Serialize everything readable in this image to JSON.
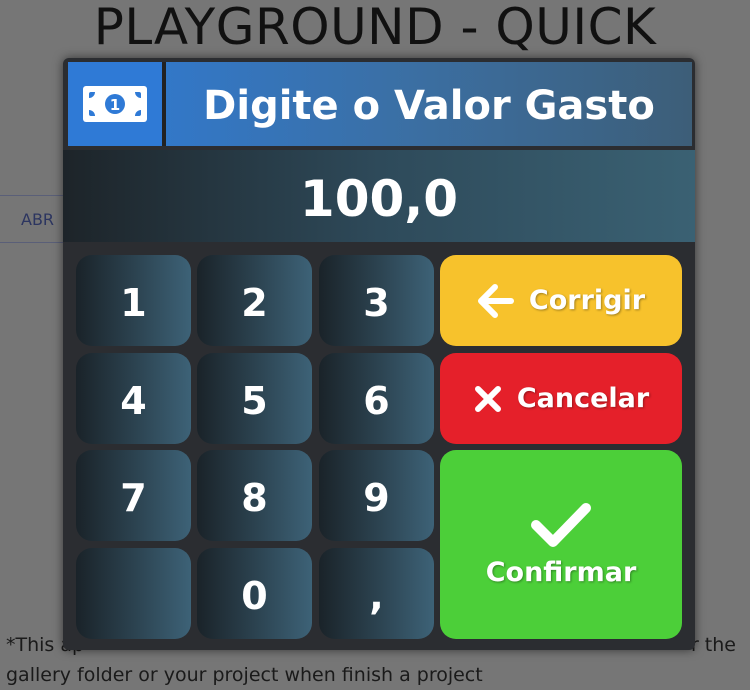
{
  "page": {
    "title": "PLAYGROUND - QUICK",
    "background_button": "ABR",
    "footnote_left": "*This ap",
    "footnote_right": "r the",
    "footnote_line2": "gallery folder or your project when finish a project"
  },
  "dialog": {
    "title": "Digite o Valor Gasto",
    "header_icon": "money-bill-icon",
    "value": "100,0",
    "keys": [
      "1",
      "2",
      "3",
      "4",
      "5",
      "6",
      "7",
      "8",
      "9",
      "",
      "0",
      ","
    ],
    "buttons": {
      "correct": "Corrigir",
      "cancel": "Cancelar",
      "confirm": "Confirmar"
    },
    "colors": {
      "header": "#2f7ad6",
      "correct": "#f7c22c",
      "cancel": "#e5202a",
      "confirm": "#4ccf39"
    }
  }
}
